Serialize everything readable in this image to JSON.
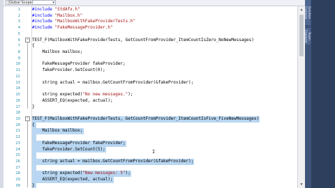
{
  "scope": {
    "value": "(Global Scope)"
  },
  "sidebar": {
    "tabs": [
      "Solution Explorer",
      "Team Explorer"
    ]
  },
  "code_lines": [
    {
      "n": "1",
      "tokens": [
        {
          "t": "pp",
          "v": "#include "
        },
        {
          "t": "str",
          "v": "\"StdAfx.h\""
        }
      ]
    },
    {
      "n": "2",
      "tokens": [
        {
          "t": "pp",
          "v": "#include "
        },
        {
          "t": "str",
          "v": "\"Mailbox.h\""
        }
      ]
    },
    {
      "n": "3",
      "tokens": [
        {
          "t": "pp",
          "v": "#include "
        },
        {
          "t": "str",
          "v": "\"MailboxWithFakeProviderTests.h\""
        }
      ]
    },
    {
      "n": "4",
      "tokens": [
        {
          "t": "pp",
          "v": "#include "
        },
        {
          "t": "str",
          "v": "\"FakeMessageProvider.h\""
        }
      ]
    },
    {
      "n": "5",
      "tokens": []
    },
    {
      "n": "6",
      "tokens": [
        {
          "t": "plain",
          "v": "TEST_F(MailboxWithFakeProviderTests, GetCountFromProvider_ItemCountIsZero_NoNewMessages)"
        }
      ]
    },
    {
      "n": "7",
      "tokens": [
        {
          "t": "plain",
          "v": "{"
        }
      ]
    },
    {
      "n": "8",
      "tokens": [
        {
          "t": "plain",
          "v": "    Mailbox mailbox;"
        }
      ]
    },
    {
      "n": "9",
      "tokens": []
    },
    {
      "n": "10",
      "tokens": [
        {
          "t": "plain",
          "v": "    FakeMessageProvider fakeProvider;"
        }
      ]
    },
    {
      "n": "11",
      "tokens": [
        {
          "t": "plain",
          "v": "    fakeProvider.SetCount(0);"
        }
      ]
    },
    {
      "n": "12",
      "tokens": []
    },
    {
      "n": "13",
      "tokens": [
        {
          "t": "plain",
          "v": "    string actual = mailbox.GetCountFromProvider(&fakeProvider);"
        }
      ]
    },
    {
      "n": "14",
      "tokens": []
    },
    {
      "n": "15",
      "tokens": [
        {
          "t": "plain",
          "v": "    string expected("
        },
        {
          "t": "str",
          "v": "\"No new messages.\""
        },
        {
          "t": "plain",
          "v": ");"
        }
      ]
    },
    {
      "n": "16",
      "tokens": [
        {
          "t": "plain",
          "v": "    ASSERT_EQ(expected, actual);"
        }
      ]
    },
    {
      "n": "17",
      "tokens": [
        {
          "t": "plain",
          "v": "}"
        }
      ]
    },
    {
      "n": "18",
      "tokens": []
    },
    {
      "n": "19",
      "tokens": [
        {
          "t": "plain",
          "v": "TEST_F(MailboxWithFakeProviderTests, GetCountFromProvider_ItemCountIsFive_FiveNewMessages)"
        }
      ],
      "sel": true
    },
    {
      "n": "20",
      "tokens": [
        {
          "t": "plain",
          "v": "{"
        }
      ],
      "sel": true
    },
    {
      "n": "21",
      "tokens": [
        {
          "t": "plain",
          "v": "    Mailbox mailbox;"
        }
      ],
      "sel": true
    },
    {
      "n": "22",
      "tokens": [],
      "sel": true
    },
    {
      "n": "23",
      "tokens": [
        {
          "t": "plain",
          "v": "    FakeMessageProvider fakeProvider;"
        }
      ],
      "sel": true
    },
    {
      "n": "24",
      "tokens": [
        {
          "t": "plain",
          "v": "    fakeProvider.SetCount(5);"
        }
      ],
      "sel": true
    },
    {
      "n": "25",
      "tokens": [],
      "sel": true
    },
    {
      "n": "26",
      "tokens": [
        {
          "t": "plain",
          "v": "    string actual = mailbox.GetCountFromProvider(&fakeProvider);"
        }
      ],
      "sel": true
    },
    {
      "n": "27",
      "tokens": [],
      "sel": true
    },
    {
      "n": "28",
      "tokens": [
        {
          "t": "plain",
          "v": "    string expected("
        },
        {
          "t": "str",
          "v": "\"New messages: 5\""
        },
        {
          "t": "plain",
          "v": ");"
        }
      ],
      "sel": true
    },
    {
      "n": "29",
      "tokens": [
        {
          "t": "plain",
          "v": "    ASSERT_EQ(expected, actual);"
        }
      ],
      "sel": true
    },
    {
      "n": "30",
      "tokens": [
        {
          "t": "plain",
          "v": "}"
        }
      ],
      "sel": true
    }
  ],
  "colors": {
    "selection": "#b9d7f2",
    "keyword": "#0000ff",
    "string": "#a31515",
    "line_number": "#2b91af"
  },
  "icons": {
    "collapse": "minus-box-icon",
    "caret": "i-beam-cursor-icon"
  }
}
